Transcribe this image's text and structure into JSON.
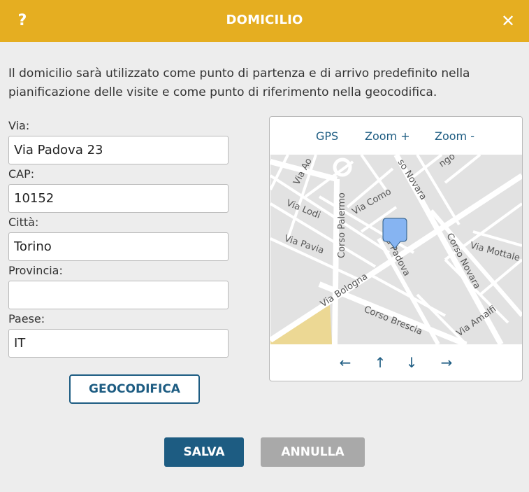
{
  "header": {
    "help_label": "?",
    "title": "DOMICILIO",
    "close_label": "✕"
  },
  "intro_text": "Il domicilio sarà utilizzato come punto di partenza e di arrivo predefinito nella pianificazione delle visite e come punto di riferimento nella geocodifica.",
  "form": {
    "via": {
      "label": "Via:",
      "value": "Via Padova 23"
    },
    "cap": {
      "label": "CAP:",
      "value": "10152"
    },
    "citta": {
      "label": "Città:",
      "value": "Torino"
    },
    "provincia": {
      "label": "Provincia:",
      "value": ""
    },
    "paese": {
      "label": "Paese:",
      "value": "IT"
    }
  },
  "geocode_button": "GEOCODIFICA",
  "map": {
    "controls": {
      "gps": "GPS",
      "zoom_in": "Zoom +",
      "zoom_out": "Zoom -"
    },
    "street_labels": {
      "via_ao": "Via Ao",
      "corso_novara_top": "so Novara",
      "ngo": "ngo",
      "via_lodi": "Via Lodi",
      "via_como": "Via Como",
      "corso_palermo": "Corso Palermo",
      "via_pavia": "Via Pavia",
      "via_padova": "a Padova",
      "corso_novara": "Corso Novara",
      "via_mottale": "Via Mottale",
      "via_bologna": "Via Bologna",
      "corso_brescia": "Corso Brescia",
      "via_amalfi": "Via Amalfi"
    },
    "pan": {
      "left": "←",
      "up": "↑",
      "down": "↓",
      "right": "→"
    },
    "colors": {
      "background": "#e2e2e2",
      "road": "#ffffff",
      "park": "#ecd894",
      "marker": "#86b4f2"
    }
  },
  "actions": {
    "save": "SALVA",
    "cancel": "ANNULLA"
  },
  "colors": {
    "header": "#e5ae21",
    "primary": "#1d5c82",
    "disabled": "#a9a9a9"
  }
}
